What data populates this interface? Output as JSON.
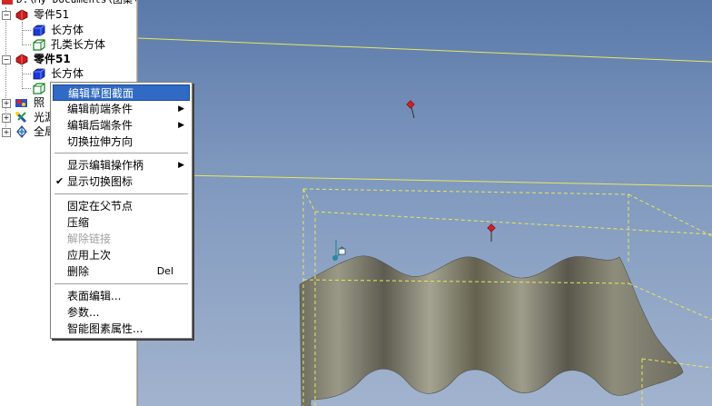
{
  "tree": {
    "path_label": "D:\\My Documents\\图案\\",
    "items": [
      {
        "label": "零件51",
        "bold": false
      },
      {
        "label": "长方体"
      },
      {
        "label": "孔类长方体"
      },
      {
        "label": "零件51",
        "bold": true
      },
      {
        "label": "长方体"
      },
      {
        "label": "照"
      },
      {
        "label": "光源"
      },
      {
        "label": "全局"
      }
    ]
  },
  "context_menu": {
    "items": [
      {
        "label": "编辑草图截面",
        "selected": true
      },
      {
        "label": "编辑前端条件",
        "submenu": true
      },
      {
        "label": "编辑后端条件",
        "submenu": true
      },
      {
        "label": "切换拉伸方向"
      },
      {
        "label": "显示编辑操作柄",
        "submenu": true
      },
      {
        "label": "显示切换图标",
        "checked": true
      },
      {
        "label": "固定在父节点"
      },
      {
        "label": "压缩"
      },
      {
        "label": "解除链接",
        "disabled": true
      },
      {
        "label": "应用上次"
      },
      {
        "label": "删除",
        "shortcut": "Del"
      },
      {
        "label": "表面编辑..."
      },
      {
        "label": "参数..."
      },
      {
        "label": "智能图素属性..."
      }
    ],
    "check_mark": "✔",
    "submenu_arrow": "▶"
  },
  "colors": {
    "selection": "#316ac5",
    "surface": "#8c8a78",
    "bbox": "#e8e85a",
    "handle": "#d0202a",
    "anchor": "#2a8a9a"
  }
}
